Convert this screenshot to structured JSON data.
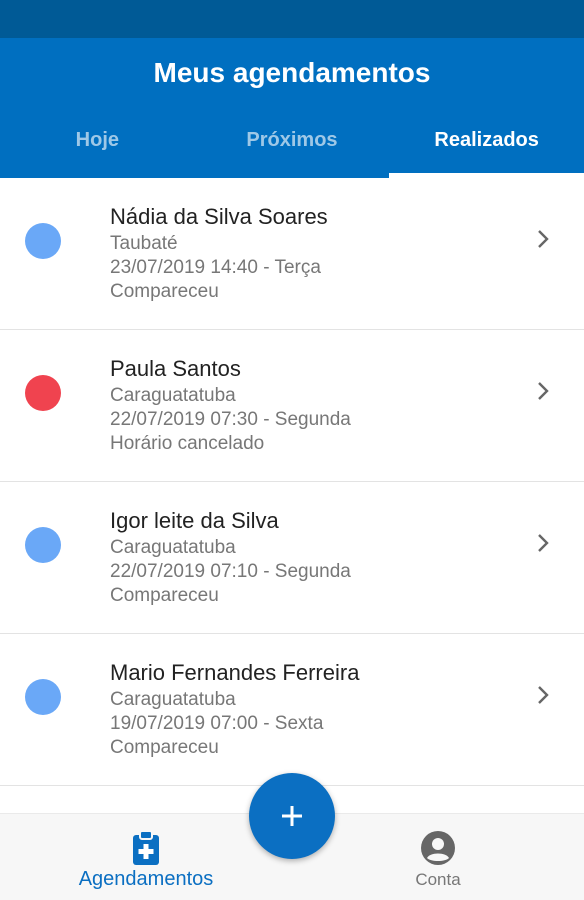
{
  "header": {
    "title": "Meus agendamentos",
    "tabs": [
      {
        "label": "Hoje"
      },
      {
        "label": "Próximos"
      },
      {
        "label": "Realizados"
      }
    ],
    "active_tab": "Realizados"
  },
  "appointments": [
    {
      "name": "Nádia da Silva Soares",
      "city": "Taubaté",
      "datetime": "23/07/2019 14:40 - Terça",
      "status": "Compareceu",
      "dot_color": "#6aa8f7"
    },
    {
      "name": "Paula Santos",
      "city": "Caraguatatuba",
      "datetime": "22/07/2019 07:30 - Segunda",
      "status": "Horário cancelado",
      "dot_color": "#f0434f"
    },
    {
      "name": "Igor leite da Silva",
      "city": "Caraguatatuba",
      "datetime": "22/07/2019 07:10 - Segunda",
      "status": "Compareceu",
      "dot_color": "#6aa8f7"
    },
    {
      "name": "Mario Fernandes Ferreira",
      "city": "Caraguatatuba",
      "datetime": "19/07/2019 07:00 - Sexta",
      "status": "Compareceu",
      "dot_color": "#6aa8f7"
    }
  ],
  "fab": {
    "icon": "plus-icon"
  },
  "bottom_nav": {
    "items": [
      {
        "label": "Agendamentos",
        "icon": "clipboard-medical-icon",
        "active": true
      },
      {
        "label": "Conta",
        "icon": "account-circle-icon",
        "active": false
      }
    ]
  },
  "colors": {
    "primary": "#006fc0",
    "status_bar": "#005a96",
    "attended_dot": "#6aa8f7",
    "cancelled_dot": "#f0434f"
  }
}
